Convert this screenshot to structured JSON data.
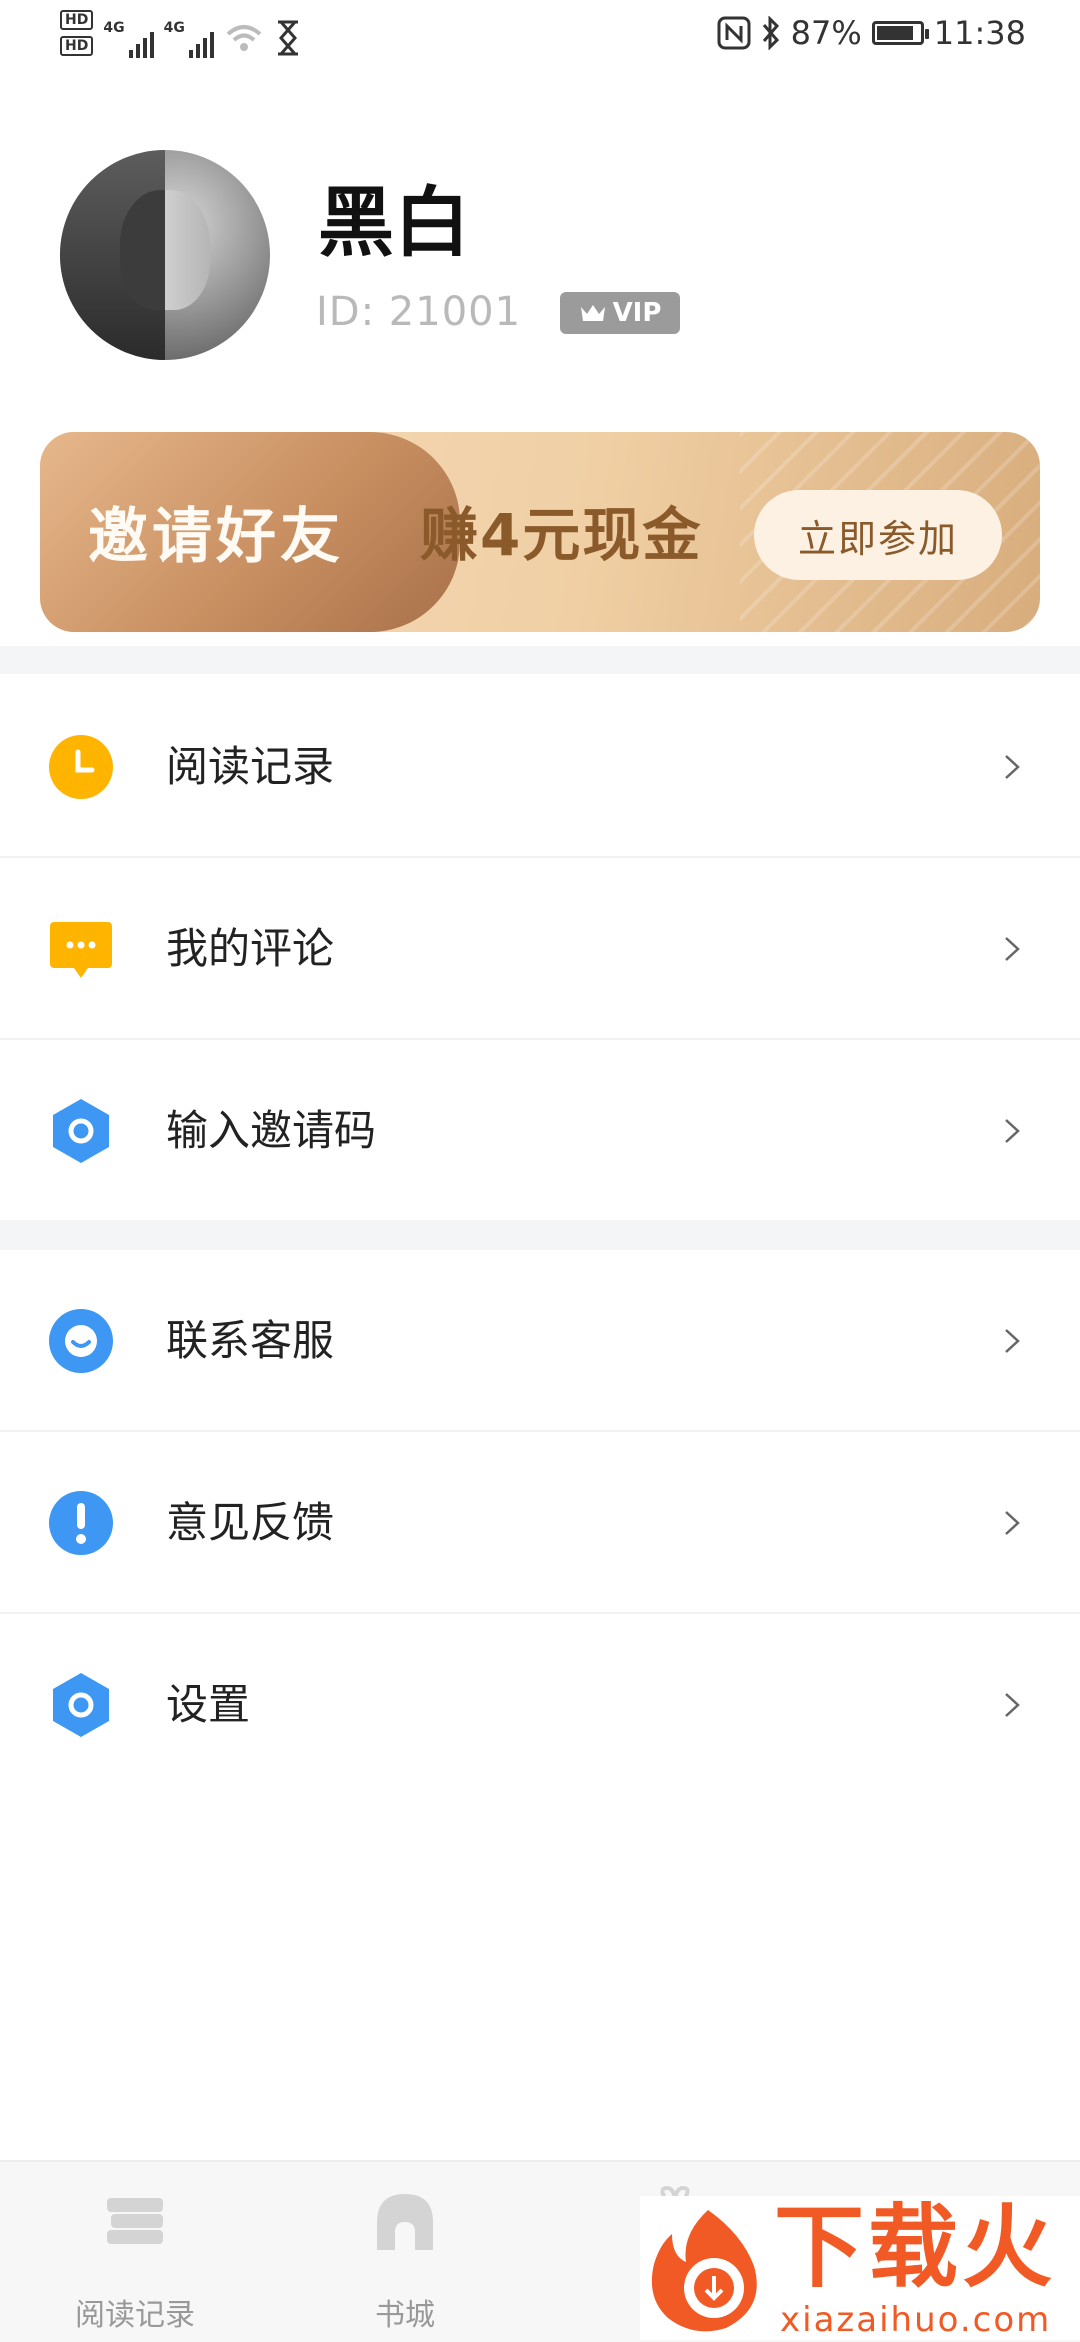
{
  "status_bar": {
    "hd1": "HD",
    "hd2": "HD",
    "net1": "4G",
    "net2": "4G",
    "battery_percent": "87%",
    "time": "11:38",
    "battery_level": 0.87
  },
  "profile": {
    "name": "黑白",
    "id_text": "ID:  21001",
    "badge": "VIP"
  },
  "banner": {
    "invite_text": "邀请好友",
    "earn_text": "赚4元现金",
    "join_button": "立即参加"
  },
  "menu_group_1": [
    {
      "label": "阅读记录",
      "icon": "clock-icon",
      "color": "#FFB400"
    },
    {
      "label": "我的评论",
      "icon": "comment-icon",
      "color": "#FFB400"
    },
    {
      "label": "输入邀请码",
      "icon": "invite-code-icon",
      "color": "#3D97F3"
    }
  ],
  "menu_group_2": [
    {
      "label": "联系客服",
      "icon": "customer-service-icon",
      "color": "#3D97F3"
    },
    {
      "label": "意见反馈",
      "icon": "feedback-icon",
      "color": "#3D97F3"
    },
    {
      "label": "设置",
      "icon": "settings-icon",
      "color": "#3D97F3"
    }
  ],
  "tabbar": [
    {
      "label": "阅读记录",
      "icon": "books-icon"
    },
    {
      "label": "书城",
      "icon": "bookstore-icon"
    }
  ],
  "watermark": {
    "title": "下载火",
    "url": "xiazaihuo.com"
  }
}
